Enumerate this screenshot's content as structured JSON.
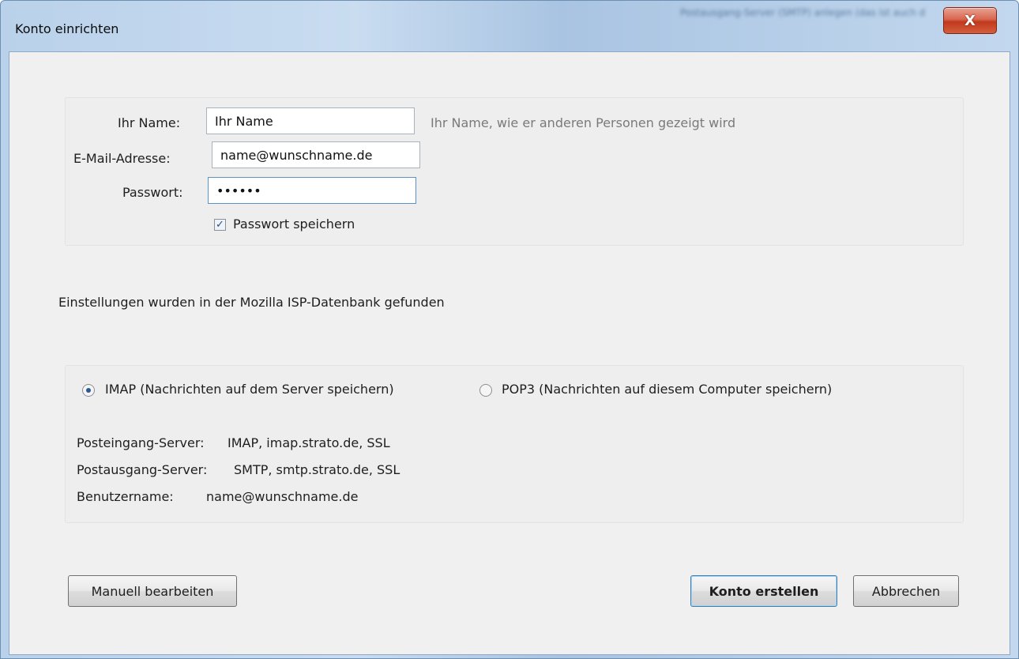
{
  "window": {
    "title": "Konto einrichten",
    "background_text": "Postausgang-Server (SMTP) anlegen (das ist auch der Fall, wenn zwar der Servername gleich, aber der Benutzername verschieden ist).",
    "close_glyph": "X"
  },
  "identity": {
    "name_label": "Ihr Name:",
    "name_value": "Ihr Name",
    "name_hint": "Ihr Name, wie er anderen Personen gezeigt wird",
    "email_label": "E-Mail-Adresse:",
    "email_value": "name@wunschname.de",
    "password_label": "Passwort:",
    "password_value": "••••••",
    "save_password_label": "Passwort speichern",
    "save_password_checked": true
  },
  "status_message": "Einstellungen wurden in der Mozilla ISP-Datenbank gefunden",
  "protocol": {
    "imap_label": "IMAP (Nachrichten auf dem Server speichern)",
    "pop3_label": "POP3 (Nachrichten auf diesem Computer speichern)",
    "selected": "IMAP",
    "incoming_label": "Posteingang-Server:",
    "incoming_value": "IMAP, imap.strato.de, SSL",
    "outgoing_label": "Postausgang-Server:",
    "outgoing_value": "SMTP, smtp.strato.de, SSL",
    "username_label": "Benutzername:",
    "username_value": "name@wunschname.de"
  },
  "buttons": {
    "manual": "Manuell bearbeiten",
    "create": "Konto erstellen",
    "cancel": "Abbrechen"
  },
  "colors": {
    "titlebar": "#b9d1ea",
    "close_button": "#c2391c",
    "client_bg": "#f0f0f0",
    "radio_dot": "#2b5796"
  }
}
